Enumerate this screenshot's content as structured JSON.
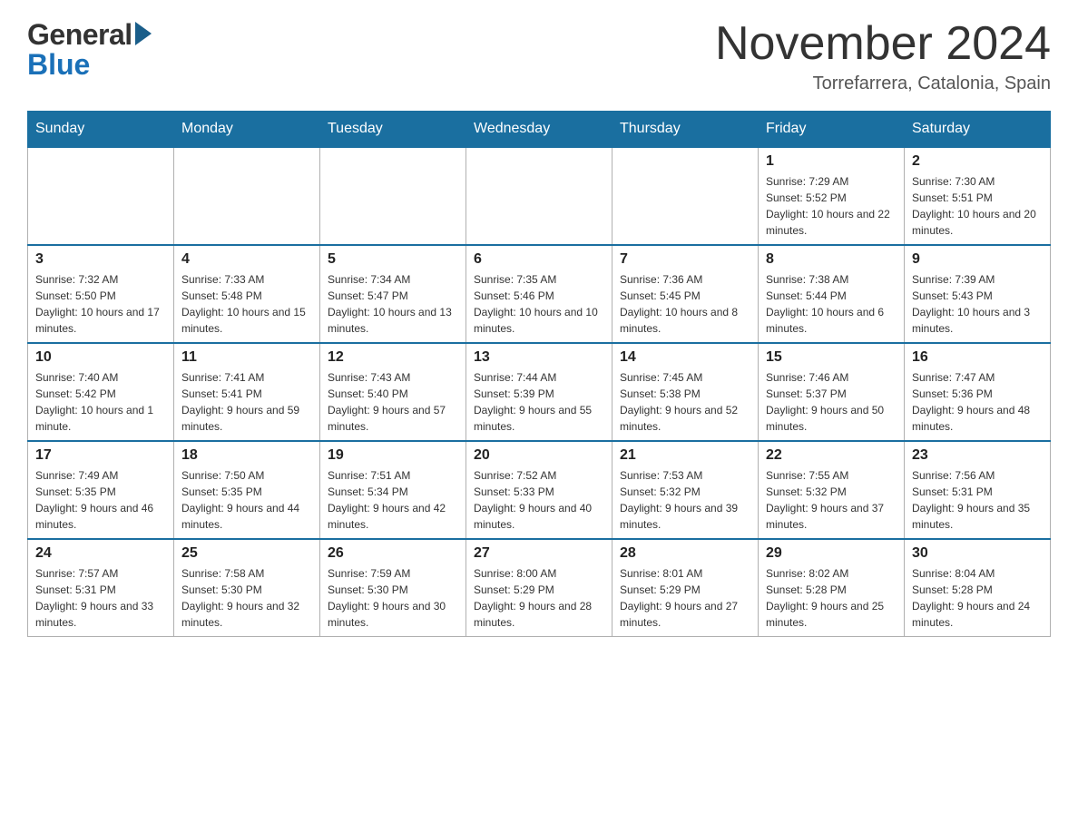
{
  "header": {
    "logo_general": "General",
    "logo_blue": "Blue",
    "month_title": "November 2024",
    "location": "Torrefarrera, Catalonia, Spain"
  },
  "calendar": {
    "days_of_week": [
      "Sunday",
      "Monday",
      "Tuesday",
      "Wednesday",
      "Thursday",
      "Friday",
      "Saturday"
    ],
    "weeks": [
      {
        "days": [
          {
            "day": "",
            "info": ""
          },
          {
            "day": "",
            "info": ""
          },
          {
            "day": "",
            "info": ""
          },
          {
            "day": "",
            "info": ""
          },
          {
            "day": "",
            "info": ""
          },
          {
            "day": "1",
            "info": "Sunrise: 7:29 AM\nSunset: 5:52 PM\nDaylight: 10 hours and 22 minutes."
          },
          {
            "day": "2",
            "info": "Sunrise: 7:30 AM\nSunset: 5:51 PM\nDaylight: 10 hours and 20 minutes."
          }
        ]
      },
      {
        "days": [
          {
            "day": "3",
            "info": "Sunrise: 7:32 AM\nSunset: 5:50 PM\nDaylight: 10 hours and 17 minutes."
          },
          {
            "day": "4",
            "info": "Sunrise: 7:33 AM\nSunset: 5:48 PM\nDaylight: 10 hours and 15 minutes."
          },
          {
            "day": "5",
            "info": "Sunrise: 7:34 AM\nSunset: 5:47 PM\nDaylight: 10 hours and 13 minutes."
          },
          {
            "day": "6",
            "info": "Sunrise: 7:35 AM\nSunset: 5:46 PM\nDaylight: 10 hours and 10 minutes."
          },
          {
            "day": "7",
            "info": "Sunrise: 7:36 AM\nSunset: 5:45 PM\nDaylight: 10 hours and 8 minutes."
          },
          {
            "day": "8",
            "info": "Sunrise: 7:38 AM\nSunset: 5:44 PM\nDaylight: 10 hours and 6 minutes."
          },
          {
            "day": "9",
            "info": "Sunrise: 7:39 AM\nSunset: 5:43 PM\nDaylight: 10 hours and 3 minutes."
          }
        ]
      },
      {
        "days": [
          {
            "day": "10",
            "info": "Sunrise: 7:40 AM\nSunset: 5:42 PM\nDaylight: 10 hours and 1 minute."
          },
          {
            "day": "11",
            "info": "Sunrise: 7:41 AM\nSunset: 5:41 PM\nDaylight: 9 hours and 59 minutes."
          },
          {
            "day": "12",
            "info": "Sunrise: 7:43 AM\nSunset: 5:40 PM\nDaylight: 9 hours and 57 minutes."
          },
          {
            "day": "13",
            "info": "Sunrise: 7:44 AM\nSunset: 5:39 PM\nDaylight: 9 hours and 55 minutes."
          },
          {
            "day": "14",
            "info": "Sunrise: 7:45 AM\nSunset: 5:38 PM\nDaylight: 9 hours and 52 minutes."
          },
          {
            "day": "15",
            "info": "Sunrise: 7:46 AM\nSunset: 5:37 PM\nDaylight: 9 hours and 50 minutes."
          },
          {
            "day": "16",
            "info": "Sunrise: 7:47 AM\nSunset: 5:36 PM\nDaylight: 9 hours and 48 minutes."
          }
        ]
      },
      {
        "days": [
          {
            "day": "17",
            "info": "Sunrise: 7:49 AM\nSunset: 5:35 PM\nDaylight: 9 hours and 46 minutes."
          },
          {
            "day": "18",
            "info": "Sunrise: 7:50 AM\nSunset: 5:35 PM\nDaylight: 9 hours and 44 minutes."
          },
          {
            "day": "19",
            "info": "Sunrise: 7:51 AM\nSunset: 5:34 PM\nDaylight: 9 hours and 42 minutes."
          },
          {
            "day": "20",
            "info": "Sunrise: 7:52 AM\nSunset: 5:33 PM\nDaylight: 9 hours and 40 minutes."
          },
          {
            "day": "21",
            "info": "Sunrise: 7:53 AM\nSunset: 5:32 PM\nDaylight: 9 hours and 39 minutes."
          },
          {
            "day": "22",
            "info": "Sunrise: 7:55 AM\nSunset: 5:32 PM\nDaylight: 9 hours and 37 minutes."
          },
          {
            "day": "23",
            "info": "Sunrise: 7:56 AM\nSunset: 5:31 PM\nDaylight: 9 hours and 35 minutes."
          }
        ]
      },
      {
        "days": [
          {
            "day": "24",
            "info": "Sunrise: 7:57 AM\nSunset: 5:31 PM\nDaylight: 9 hours and 33 minutes."
          },
          {
            "day": "25",
            "info": "Sunrise: 7:58 AM\nSunset: 5:30 PM\nDaylight: 9 hours and 32 minutes."
          },
          {
            "day": "26",
            "info": "Sunrise: 7:59 AM\nSunset: 5:30 PM\nDaylight: 9 hours and 30 minutes."
          },
          {
            "day": "27",
            "info": "Sunrise: 8:00 AM\nSunset: 5:29 PM\nDaylight: 9 hours and 28 minutes."
          },
          {
            "day": "28",
            "info": "Sunrise: 8:01 AM\nSunset: 5:29 PM\nDaylight: 9 hours and 27 minutes."
          },
          {
            "day": "29",
            "info": "Sunrise: 8:02 AM\nSunset: 5:28 PM\nDaylight: 9 hours and 25 minutes."
          },
          {
            "day": "30",
            "info": "Sunrise: 8:04 AM\nSunset: 5:28 PM\nDaylight: 9 hours and 24 minutes."
          }
        ]
      }
    ]
  }
}
